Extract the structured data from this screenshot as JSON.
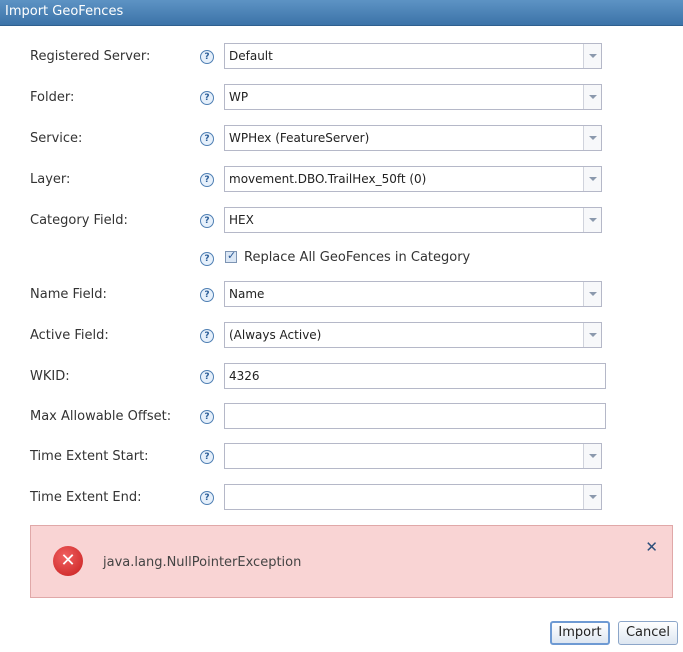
{
  "window": {
    "title": "Import GeoFences"
  },
  "form": {
    "registered_server": {
      "label": "Registered Server:",
      "value": "Default"
    },
    "folder": {
      "label": "Folder:",
      "value": "WP"
    },
    "service": {
      "label": "Service:",
      "value": "WPHex (FeatureServer)"
    },
    "layer": {
      "label": "Layer:",
      "value": "movement.DBO.TrailHex_50ft (0)"
    },
    "category_field": {
      "label": "Category Field:",
      "value": "HEX"
    },
    "replace_all": {
      "label": "Replace All GeoFences in Category",
      "checked": true
    },
    "name_field": {
      "label": "Name Field:",
      "value": "Name"
    },
    "active_field": {
      "label": "Active Field:",
      "value": "(Always Active)"
    },
    "wkid": {
      "label": "WKID:",
      "value": "4326"
    },
    "max_offset": {
      "label": "Max Allowable Offset:",
      "value": ""
    },
    "time_start": {
      "label": "Time Extent Start:",
      "value": ""
    },
    "time_end": {
      "label": "Time Extent End:",
      "value": ""
    },
    "help_glyph": "?"
  },
  "error": {
    "message": "java.lang.NullPointerException",
    "icon": "error-icon",
    "close_glyph": "✕",
    "icon_glyph": "✕"
  },
  "buttons": {
    "import": "Import",
    "cancel": "Cancel"
  }
}
